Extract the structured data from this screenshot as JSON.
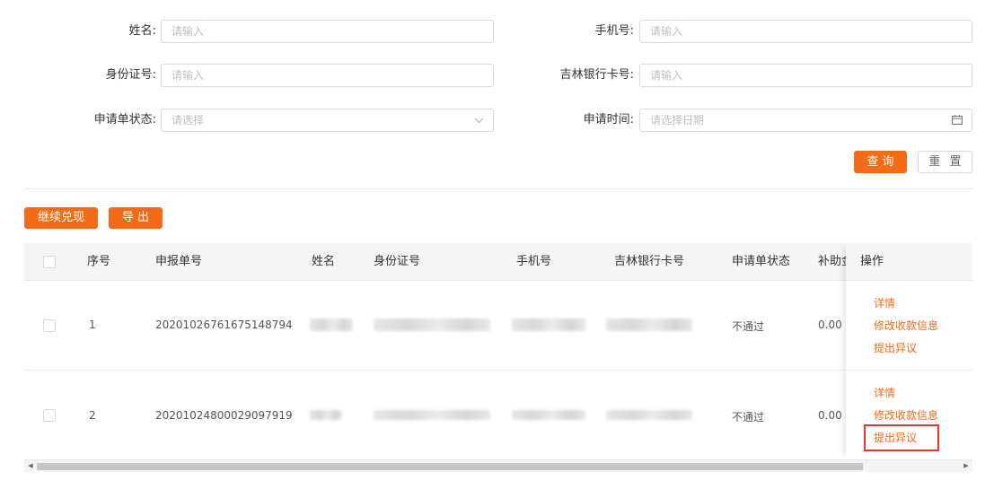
{
  "search_form": {
    "name_label": "姓名:",
    "name_placeholder": "请输入",
    "phone_label": "手机号:",
    "phone_placeholder": "请输入",
    "id_card_label": "身份证号:",
    "id_card_placeholder": "请输入",
    "bank_card_label": "吉林银行卡号:",
    "bank_card_placeholder": "请输入",
    "status_label": "申请单状态:",
    "status_placeholder": "请选择",
    "time_label": "申请时间:",
    "time_placeholder": "请选择日期",
    "query_button": "查 询",
    "reset_button": "重 置"
  },
  "toolbar": {
    "continue_redeem_button": "继续兑现",
    "export_button": "导 出"
  },
  "table": {
    "columns": [
      "序号",
      "申报单号",
      "姓名",
      "身份证号",
      "手机号",
      "吉林银行卡号",
      "申请单状态",
      "补助金",
      "操作"
    ],
    "rows": [
      {
        "index": "1",
        "report_no": "20201026761675148794",
        "status": "不通过",
        "subsidy": "0.00",
        "actions": [
          "详情",
          "修改收款信息",
          "提出异议"
        ]
      },
      {
        "index": "2",
        "report_no": "20201024800029097919",
        "status": "不通过",
        "subsidy": "0.00",
        "actions": [
          "详情",
          "修改收款信息",
          "提出异议"
        ]
      }
    ]
  },
  "icons": {
    "select_arrow": "chevron-down-icon",
    "date_picker": "calendar-icon",
    "scroll_left": "caret-left-icon",
    "scroll_right": "caret-right-icon"
  },
  "colors": {
    "accent": "#f36b17",
    "highlight": "#e0352b",
    "header_bg": "#f5f5f5"
  }
}
